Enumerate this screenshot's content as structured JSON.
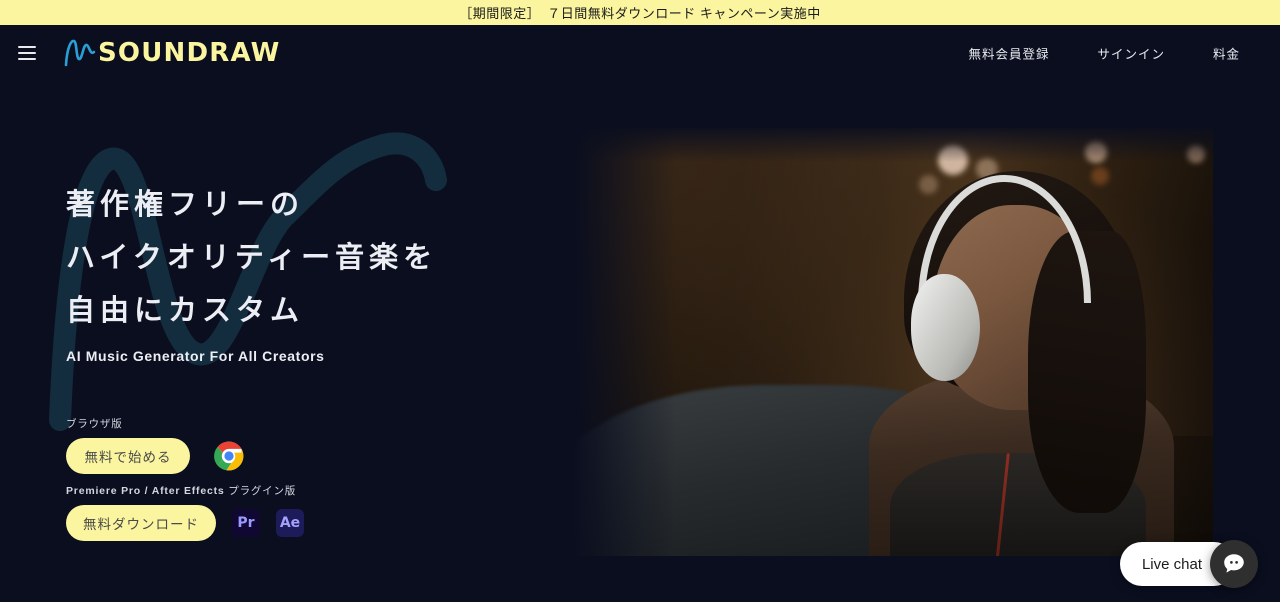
{
  "promo_banner": {
    "text": "［期間限定］　７日間無料ダウンロード キャンペーン実施中"
  },
  "header": {
    "menu_icon": "hamburger-menu-icon",
    "logo_text": "SOUNDRAW",
    "logo_mark": "wave-logo-icon",
    "nav": [
      {
        "label": "無料会員登録"
      },
      {
        "label": "サインイン"
      },
      {
        "label": "料金"
      }
    ]
  },
  "hero": {
    "title_lines": [
      "著作権フリーの",
      "ハイクオリティー音楽を",
      "自由にカスタム"
    ],
    "subtitle": "AI Music Generator For All Creators",
    "cta_browser": {
      "label": "ブラウザ版",
      "button": "無料で始める",
      "icon": "chrome-icon"
    },
    "cta_plugin": {
      "label_en": "Premiere Pro / After Effects",
      "label_jp": "プラグイン版",
      "button": "無料ダウンロード",
      "icons": [
        {
          "name": "premiere-pro-icon",
          "text": "Pr"
        },
        {
          "name": "after-effects-icon",
          "text": "Ae"
        }
      ]
    },
    "photo_alt": "woman-with-headphones-photo"
  },
  "live_chat": {
    "label": "Live chat",
    "icon": "chat-bubble-icon"
  },
  "colors": {
    "banner_bg": "#faf59e",
    "page_bg": "#0a0e1f",
    "accent": "#faf59e",
    "logo_wave": "#2a9fd6",
    "text": "#eceef4"
  }
}
